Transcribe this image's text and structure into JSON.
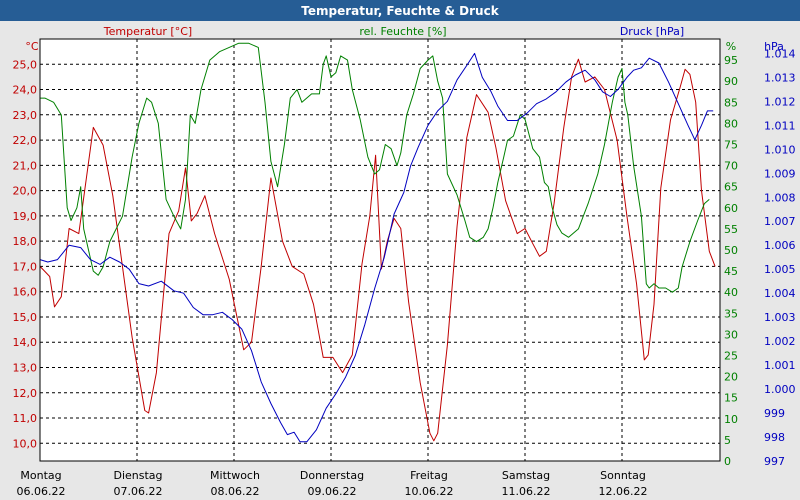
{
  "chart_data": {
    "type": "line",
    "title": "Temperatur, Feuchte & Druck",
    "legend_placement": "top",
    "colors": {
      "temperature": "#c00000",
      "humidity": "#008000",
      "pressure": "#0000c0",
      "title_bar": "#265d95",
      "title_text": "#ffffff",
      "plot_bg": "#ffffff",
      "page_bg": "#e7e7e7",
      "grid": "#000000"
    },
    "grid": true,
    "x_axis": {
      "type": "date",
      "range": [
        "06.06.22 00:00",
        "12.06.22 24:00"
      ],
      "ticks": [
        {
          "day": "Montag",
          "date": "06.06.22"
        },
        {
          "day": "Dienstag",
          "date": "07.06.22"
        },
        {
          "day": "Mittwoch",
          "date": "08.06.22"
        },
        {
          "day": "Donnerstag",
          "date": "09.06.22"
        },
        {
          "day": "Freitag",
          "date": "10.06.22"
        },
        {
          "day": "Samstag",
          "date": "11.06.22"
        },
        {
          "day": "Sonntag",
          "date": "12.06.22"
        }
      ]
    },
    "y_axes": {
      "temperature": {
        "unit": "°C",
        "range": [
          9.3,
          26.0
        ],
        "ticks": [
          "10,0",
          "11,0",
          "12,0",
          "13,0",
          "14,0",
          "15,0",
          "16,0",
          "17,0",
          "18,0",
          "19,0",
          "20,0",
          "21,0",
          "22,0",
          "23,0",
          "24,0",
          "25,0"
        ]
      },
      "humidity": {
        "unit": "%",
        "range": [
          0,
          100
        ],
        "ticks": [
          "0",
          "5",
          "10",
          "15",
          "20",
          "25",
          "30",
          "35",
          "40",
          "45",
          "50",
          "55",
          "60",
          "65",
          "70",
          "75",
          "80",
          "85",
          "90",
          "95"
        ]
      },
      "pressure": {
        "unit": "hPa",
        "range": [
          997,
          1014.6
        ],
        "ticks": [
          "997",
          "998",
          "999",
          "1.000",
          "1.001",
          "1.002",
          "1.003",
          "1.004",
          "1.005",
          "1.006",
          "1.007",
          "1.008",
          "1.009",
          "1.010",
          "1.011",
          "1.012",
          "1.013",
          "1.014"
        ]
      }
    },
    "series": [
      {
        "name": "Temperatur [°C]",
        "key": "temperature",
        "axis": "temperature",
        "points": [
          [
            0,
            17.0
          ],
          [
            0.1,
            16.6
          ],
          [
            0.15,
            15.4
          ],
          [
            0.22,
            15.8
          ],
          [
            0.3,
            18.5
          ],
          [
            0.4,
            18.3
          ],
          [
            0.55,
            22.5
          ],
          [
            0.65,
            21.8
          ],
          [
            0.75,
            19.8
          ],
          [
            0.95,
            14.2
          ],
          [
            1.08,
            11.3
          ],
          [
            1.12,
            11.2
          ],
          [
            1.2,
            12.8
          ],
          [
            1.33,
            18.3
          ],
          [
            1.43,
            19.2
          ],
          [
            1.5,
            20.9
          ],
          [
            1.56,
            18.8
          ],
          [
            1.62,
            19.1
          ],
          [
            1.7,
            19.8
          ],
          [
            1.8,
            18.3
          ],
          [
            1.95,
            16.5
          ],
          [
            2.1,
            13.7
          ],
          [
            2.18,
            14.0
          ],
          [
            2.28,
            17.0
          ],
          [
            2.38,
            20.5
          ],
          [
            2.5,
            18.0
          ],
          [
            2.6,
            17.0
          ],
          [
            2.72,
            16.7
          ],
          [
            2.82,
            15.5
          ],
          [
            2.92,
            13.4
          ],
          [
            3.02,
            13.4
          ],
          [
            3.12,
            12.8
          ],
          [
            3.22,
            13.5
          ],
          [
            3.32,
            17.1
          ],
          [
            3.4,
            19.0
          ],
          [
            3.46,
            21.4
          ],
          [
            3.52,
            16.9
          ],
          [
            3.58,
            18.0
          ],
          [
            3.65,
            18.9
          ],
          [
            3.72,
            18.5
          ],
          [
            3.8,
            15.6
          ],
          [
            3.92,
            12.4
          ],
          [
            4.02,
            10.4
          ],
          [
            4.06,
            10.1
          ],
          [
            4.1,
            10.4
          ],
          [
            4.2,
            13.9
          ],
          [
            4.3,
            18.6
          ],
          [
            4.4,
            22.1
          ],
          [
            4.5,
            23.8
          ],
          [
            4.62,
            23.1
          ],
          [
            4.7,
            21.7
          ],
          [
            4.8,
            19.6
          ],
          [
            4.92,
            18.3
          ],
          [
            5.0,
            18.5
          ],
          [
            5.08,
            17.9
          ],
          [
            5.15,
            17.4
          ],
          [
            5.22,
            17.6
          ],
          [
            5.3,
            19.5
          ],
          [
            5.4,
            22.5
          ],
          [
            5.48,
            24.5
          ],
          [
            5.55,
            25.2
          ],
          [
            5.62,
            24.3
          ],
          [
            5.72,
            24.5
          ],
          [
            5.82,
            24.0
          ],
          [
            5.95,
            22.0
          ],
          [
            6.05,
            19.0
          ],
          [
            6.15,
            16.3
          ],
          [
            6.23,
            13.3
          ],
          [
            6.27,
            13.5
          ],
          [
            6.33,
            15.5
          ],
          [
            6.4,
            20.1
          ],
          [
            6.5,
            22.8
          ],
          [
            6.6,
            24.1
          ],
          [
            6.65,
            24.8
          ],
          [
            6.7,
            24.6
          ],
          [
            6.76,
            23.5
          ],
          [
            6.82,
            20.0
          ],
          [
            6.9,
            17.6
          ],
          [
            6.96,
            17.0
          ]
        ]
      },
      {
        "name": "rel. Feuchte [%]",
        "key": "humidity",
        "axis": "humidity",
        "points": [
          [
            0,
            86
          ],
          [
            0.05,
            86
          ],
          [
            0.14,
            85
          ],
          [
            0.22,
            82
          ],
          [
            0.28,
            60
          ],
          [
            0.32,
            57
          ],
          [
            0.38,
            60
          ],
          [
            0.42,
            65
          ],
          [
            0.45,
            55
          ],
          [
            0.55,
            45
          ],
          [
            0.6,
            44
          ],
          [
            0.65,
            46
          ],
          [
            0.72,
            52
          ],
          [
            0.85,
            58
          ],
          [
            0.95,
            72
          ],
          [
            1.02,
            80
          ],
          [
            1.1,
            86
          ],
          [
            1.15,
            85
          ],
          [
            1.22,
            80
          ],
          [
            1.3,
            62
          ],
          [
            1.38,
            58
          ],
          [
            1.45,
            55
          ],
          [
            1.5,
            62
          ],
          [
            1.55,
            82
          ],
          [
            1.6,
            80
          ],
          [
            1.66,
            88
          ],
          [
            1.75,
            95
          ],
          [
            1.85,
            97
          ],
          [
            1.95,
            98
          ],
          [
            2.05,
            99
          ],
          [
            2.15,
            99
          ],
          [
            2.25,
            98
          ],
          [
            2.32,
            85
          ],
          [
            2.38,
            71
          ],
          [
            2.45,
            65
          ],
          [
            2.52,
            75
          ],
          [
            2.58,
            86
          ],
          [
            2.65,
            88
          ],
          [
            2.7,
            85
          ],
          [
            2.8,
            87
          ],
          [
            2.88,
            87
          ],
          [
            2.92,
            94
          ],
          [
            2.95,
            96
          ],
          [
            3.0,
            91
          ],
          [
            3.05,
            92
          ],
          [
            3.1,
            96
          ],
          [
            3.17,
            95
          ],
          [
            3.22,
            88
          ],
          [
            3.3,
            81
          ],
          [
            3.38,
            72
          ],
          [
            3.45,
            68
          ],
          [
            3.5,
            69
          ],
          [
            3.56,
            75
          ],
          [
            3.62,
            74
          ],
          [
            3.68,
            70
          ],
          [
            3.72,
            73
          ],
          [
            3.78,
            82
          ],
          [
            3.85,
            87
          ],
          [
            3.92,
            93
          ],
          [
            4.0,
            95
          ],
          [
            4.05,
            96
          ],
          [
            4.1,
            90
          ],
          [
            4.15,
            86
          ],
          [
            4.2,
            68
          ],
          [
            4.3,
            63
          ],
          [
            4.38,
            57
          ],
          [
            4.43,
            53
          ],
          [
            4.5,
            52
          ],
          [
            4.57,
            53
          ],
          [
            4.62,
            55
          ],
          [
            4.67,
            60
          ],
          [
            4.72,
            66
          ],
          [
            4.78,
            72
          ],
          [
            4.82,
            76
          ],
          [
            4.88,
            77
          ],
          [
            4.95,
            82
          ],
          [
            5.0,
            81
          ],
          [
            5.08,
            74
          ],
          [
            5.15,
            72
          ],
          [
            5.2,
            66
          ],
          [
            5.24,
            65
          ],
          [
            5.28,
            60
          ],
          [
            5.33,
            56
          ],
          [
            5.38,
            54
          ],
          [
            5.45,
            53
          ],
          [
            5.55,
            55
          ],
          [
            5.65,
            61
          ],
          [
            5.75,
            68
          ],
          [
            5.82,
            75
          ],
          [
            5.9,
            85
          ],
          [
            5.96,
            91
          ],
          [
            6.0,
            93
          ],
          [
            6.03,
            85
          ],
          [
            6.06,
            82
          ],
          [
            6.12,
            70
          ],
          [
            6.2,
            58
          ],
          [
            6.25,
            42
          ],
          [
            6.28,
            41
          ],
          [
            6.33,
            42
          ],
          [
            6.38,
            41
          ],
          [
            6.45,
            41
          ],
          [
            6.52,
            40
          ],
          [
            6.58,
            41
          ],
          [
            6.62,
            46
          ],
          [
            6.7,
            52
          ],
          [
            6.78,
            57
          ],
          [
            6.85,
            61
          ],
          [
            6.9,
            62
          ]
        ]
      },
      {
        "name": "Druck [hPa]",
        "key": "pressure",
        "axis": "pressure",
        "points": [
          [
            0,
            1005.4
          ],
          [
            0.08,
            1005.3
          ],
          [
            0.18,
            1005.4
          ],
          [
            0.3,
            1006.0
          ],
          [
            0.42,
            1005.9
          ],
          [
            0.52,
            1005.4
          ],
          [
            0.62,
            1005.2
          ],
          [
            0.72,
            1005.5
          ],
          [
            0.82,
            1005.3
          ],
          [
            0.92,
            1005.0
          ],
          [
            1.02,
            1004.4
          ],
          [
            1.12,
            1004.3
          ],
          [
            1.25,
            1004.5
          ],
          [
            1.38,
            1004.1
          ],
          [
            1.48,
            1004.0
          ],
          [
            1.58,
            1003.4
          ],
          [
            1.68,
            1003.1
          ],
          [
            1.78,
            1003.1
          ],
          [
            1.88,
            1003.2
          ],
          [
            1.98,
            1002.9
          ],
          [
            2.08,
            1002.5
          ],
          [
            2.18,
            1001.6
          ],
          [
            2.28,
            1000.3
          ],
          [
            2.38,
            999.4
          ],
          [
            2.48,
            998.6
          ],
          [
            2.55,
            998.1
          ],
          [
            2.62,
            998.2
          ],
          [
            2.68,
            997.8
          ],
          [
            2.75,
            997.8
          ],
          [
            2.85,
            998.3
          ],
          [
            2.95,
            999.2
          ],
          [
            3.05,
            999.8
          ],
          [
            3.15,
            1000.5
          ],
          [
            3.25,
            1001.4
          ],
          [
            3.35,
            1002.7
          ],
          [
            3.45,
            1004.2
          ],
          [
            3.55,
            1005.5
          ],
          [
            3.65,
            1007.3
          ],
          [
            3.75,
            1008.2
          ],
          [
            3.82,
            1009.3
          ],
          [
            3.9,
            1010.1
          ],
          [
            4.0,
            1011.0
          ],
          [
            4.1,
            1011.6
          ],
          [
            4.2,
            1012.0
          ],
          [
            4.3,
            1012.9
          ],
          [
            4.4,
            1013.5
          ],
          [
            4.48,
            1014.0
          ],
          [
            4.56,
            1013.0
          ],
          [
            4.65,
            1012.4
          ],
          [
            4.72,
            1011.8
          ],
          [
            4.82,
            1011.2
          ],
          [
            4.92,
            1011.2
          ],
          [
            5.02,
            1011.5
          ],
          [
            5.12,
            1011.9
          ],
          [
            5.22,
            1012.1
          ],
          [
            5.32,
            1012.4
          ],
          [
            5.42,
            1012.8
          ],
          [
            5.52,
            1013.1
          ],
          [
            5.62,
            1013.3
          ],
          [
            5.72,
            1012.9
          ],
          [
            5.8,
            1012.4
          ],
          [
            5.88,
            1012.2
          ],
          [
            5.96,
            1012.5
          ],
          [
            6.05,
            1013.0
          ],
          [
            6.12,
            1013.3
          ],
          [
            6.2,
            1013.4
          ],
          [
            6.28,
            1013.8
          ],
          [
            6.38,
            1013.6
          ],
          [
            6.48,
            1012.8
          ],
          [
            6.58,
            1011.9
          ],
          [
            6.68,
            1011.0
          ],
          [
            6.75,
            1010.4
          ],
          [
            6.82,
            1011.0
          ],
          [
            6.88,
            1011.6
          ],
          [
            6.94,
            1011.6
          ]
        ]
      }
    ]
  }
}
